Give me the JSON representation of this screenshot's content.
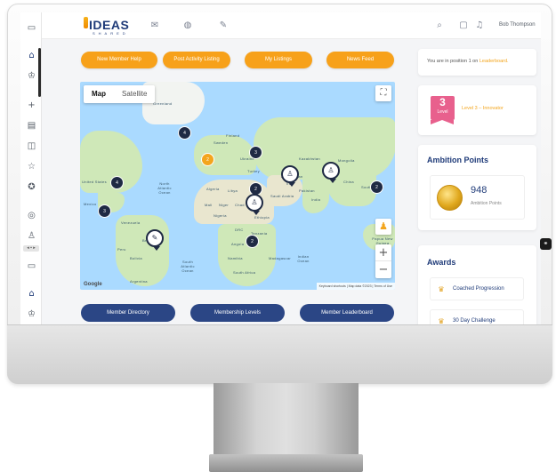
{
  "app": {
    "logo_text": "IDEAS",
    "logo_subtext": "SHARED",
    "user_name": "Bob Thompson"
  },
  "topnav": {
    "icons": [
      "mail-icon",
      "globe-icon",
      "edit-icon"
    ],
    "right_icons": [
      "search-icon",
      "inbox-icon",
      "bell-icon"
    ]
  },
  "sidebar": {
    "icons": [
      "panel-icon",
      "home-icon",
      "trophy-icon",
      "plus-icon",
      "card-icon",
      "inbox-icon",
      "star-icon",
      "badge-icon",
      "target-icon",
      "user-icon",
      "panel-icon",
      "home-icon",
      "trophy-icon"
    ]
  },
  "actions": {
    "new_member_help": "New Member Help",
    "post_activity_listing": "Post Activity Listing",
    "my_listings": "My Listings",
    "news_feed": "News Feed"
  },
  "map": {
    "type_map": "Map",
    "type_satellite": "Satellite",
    "zoom_in": "+",
    "zoom_out": "−",
    "fullscreen": "⛶",
    "pegman": "♟",
    "google": "Google",
    "attribution": "Keyboard shortcuts  |  Map data ©2023  |  Terms of Use",
    "labels": {
      "north_atlantic": "North\nAtlantic\nOcean",
      "south_atlantic": "South\nAtlantic\nOcean",
      "indian": "Indian\nOcean",
      "greenland": "Greenland",
      "united_states": "United States",
      "mexico": "Mexico",
      "venezuela": "Venezuela",
      "brazil": "Brazil",
      "peru": "Peru",
      "bolivia": "Bolivia",
      "argentina": "Argentina",
      "algeria": "Algeria",
      "libya": "Libya",
      "egypt": "Egypt",
      "mali": "Mali",
      "niger": "Niger",
      "chad": "Chad",
      "sudan": "Sudan",
      "nigeria": "Nigeria",
      "ethiopia": "Ethiopia",
      "drc": "DRC",
      "tanzania": "Tanzania",
      "angola": "Angola",
      "namibia": "Namibia",
      "south_africa": "South Africa",
      "madagascar": "Madagascar",
      "saudi_arabia": "Saudi Arabia",
      "iran": "Iran",
      "pakistan": "Pakistan",
      "india": "India",
      "afghanistan": "Afghanistan",
      "kazakhstan": "Kazakhstan",
      "mongolia": "Mongolia",
      "china": "China",
      "turkey": "Turkey",
      "ukraine": "Ukraine",
      "sweden": "Sweden",
      "finland": "Finland",
      "south_korea": "South Korea",
      "papua": "Papua New Guinea"
    },
    "clusters": [
      "4",
      "4",
      "3",
      "3",
      "2",
      "2",
      "2",
      "2"
    ],
    "orange_cluster": "2"
  },
  "bottom_buttons": {
    "member_directory": "Member Directory",
    "membership_levels": "Membership Levels",
    "member_leaderboard": "Member Leaderboard"
  },
  "position": {
    "prefix": "You are in position 1 on ",
    "link": "Leaderboard."
  },
  "level": {
    "number": "3",
    "word": "Level",
    "text": "Level 3 – Innovator"
  },
  "ambition": {
    "title": "Ambition Points",
    "points": "948",
    "label": "Ambition Points"
  },
  "awards": {
    "title": "Awards",
    "items": [
      "Coached Progression",
      "30 Day Challenge"
    ]
  }
}
